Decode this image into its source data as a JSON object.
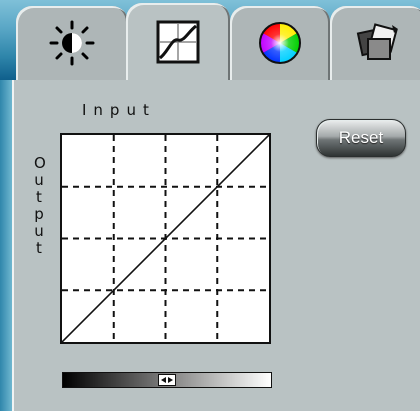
{
  "tabs": [
    {
      "name": "brightness-contrast",
      "icon": "brightness-contrast-icon",
      "active": false
    },
    {
      "name": "curves",
      "icon": "curve-graph-icon",
      "active": true
    },
    {
      "name": "color",
      "icon": "color-wheel-icon",
      "active": false
    },
    {
      "name": "transform",
      "icon": "transform-icon",
      "active": false
    }
  ],
  "curves": {
    "input_label": "Input",
    "output_label": "Output",
    "reset_label": "Reset",
    "grid_divisions": 4,
    "curve_points": [
      [
        0,
        0
      ],
      [
        255,
        255
      ]
    ]
  },
  "slider": {
    "value": 0.5
  },
  "colors": {
    "panel": "#b9c2c3",
    "tab_strip": "#2f86ab",
    "grid_line": "#111111"
  }
}
